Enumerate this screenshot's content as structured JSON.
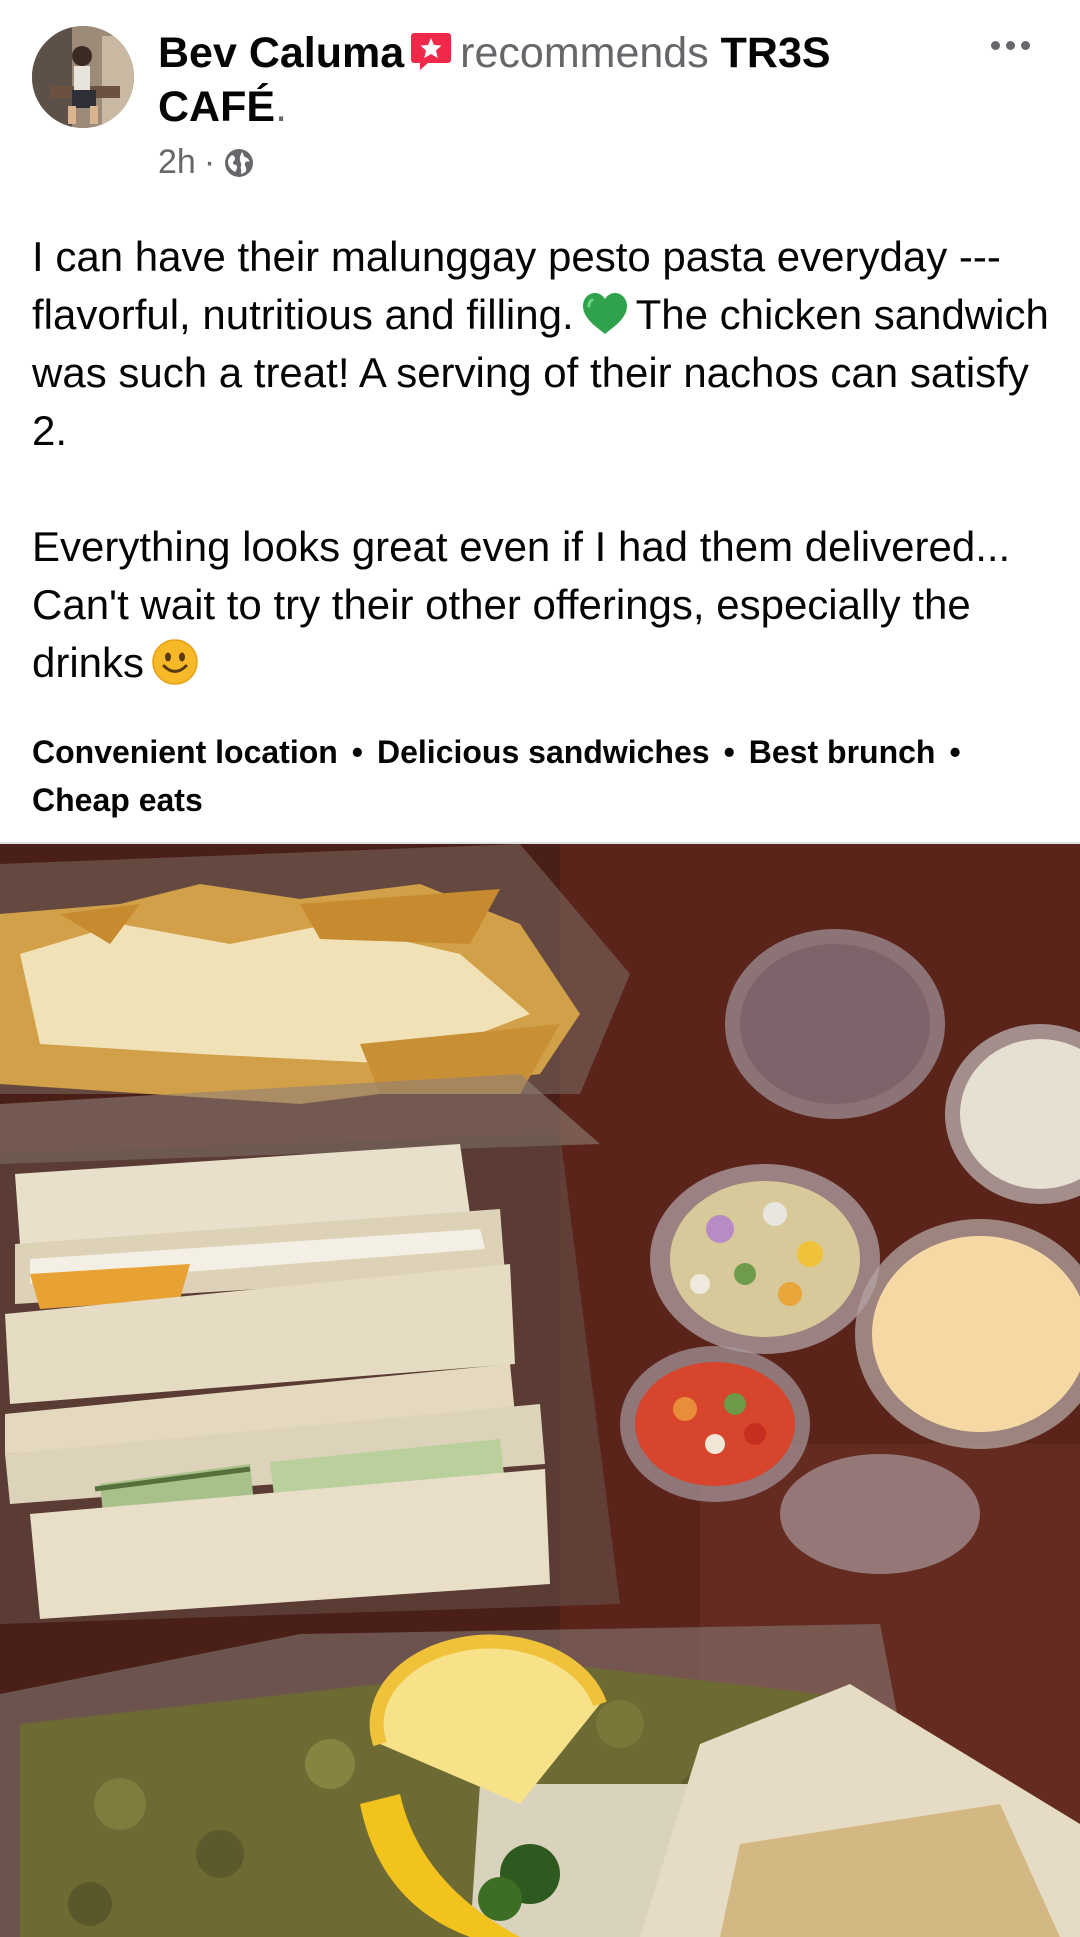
{
  "post": {
    "author": "Bev Caluma",
    "action": "recommends",
    "page_name": "TR3S CAFÉ",
    "page_name_suffix": ".",
    "timestamp": "2h",
    "separator": "·",
    "privacy_icon": "globe-icon",
    "more_icon": "more-options-icon",
    "paragraph_1a": "I can have their malunggay pesto pasta everyday --- flavorful, nutritious and filling.",
    "paragraph_1b": "The chicken sandwich was such a treat! A serving of their nachos can satisfy 2.",
    "paragraph_2": "Everything looks great even if I had them delivered... Can't wait to try their other offerings, especially the drinks",
    "emoji_1": "green-heart-icon",
    "emoji_2": "smiling-face-icon",
    "tags": [
      "Convenient location",
      "Delicious sandwiches",
      "Best brunch",
      "Cheap eats"
    ],
    "tag_separator": "•",
    "photo_description_icon": "food-photo"
  },
  "colors": {
    "secondary_text": "#65676b",
    "recommend_badge": "#f02849",
    "heart": "#31a24c",
    "emoji_face": "#f7b928"
  }
}
